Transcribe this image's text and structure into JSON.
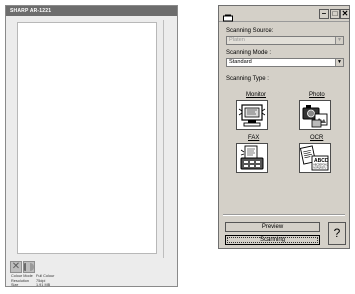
{
  "preview_window": {
    "title": "SHARP AR-1221",
    "info": [
      {
        "label": "Colour Mode",
        "value": "Full Colour"
      },
      {
        "label": "Resolution",
        "value": "75dpi"
      },
      {
        "label": "Size",
        "value": "1.91 MB"
      }
    ]
  },
  "dialog": {
    "scanning_source": {
      "label": "Scanning Source:",
      "value": "Platen"
    },
    "scanning_mode": {
      "label": "Scanning Mode :",
      "value": "Standard"
    },
    "scanning_type": {
      "label": "Scanning Type :",
      "options": [
        {
          "label": "Monitor"
        },
        {
          "label": "Photo"
        },
        {
          "label": "FAX"
        },
        {
          "label": "OCR"
        }
      ]
    },
    "buttons": {
      "preview": "Preview",
      "scanning": "Scanning",
      "help": "?"
    },
    "ocr_sample": [
      "ABCD",
      "ABCDEFGHIJ",
      "NOPQRSTU"
    ]
  }
}
